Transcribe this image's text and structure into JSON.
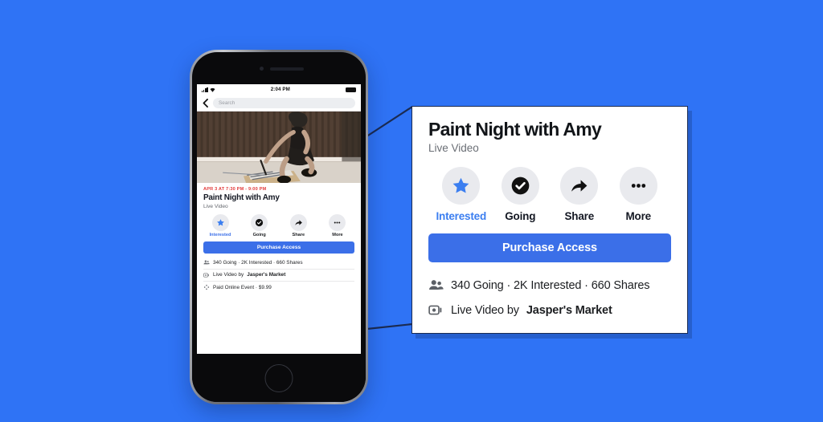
{
  "colors": {
    "background_blue": "#2f73f5",
    "brand_blue": "#3b6fe8",
    "interested_blue": "#3b7ef0",
    "panel_border": "#1b2b52",
    "date_red": "#e23b3b",
    "icon_circle_grey": "#e9eaee",
    "muted_text": "#65686e"
  },
  "phone": {
    "status_bar": {
      "time": "2:04 PM",
      "signal_icon": "signal-bars-icon",
      "wifi_icon": "wifi-icon",
      "battery_icon": "battery-icon"
    },
    "nav": {
      "back_icon": "back-chevron-icon",
      "search_placeholder": "Search",
      "search_value": ""
    },
    "hero": {
      "image_alt": "person crouching painting on a board",
      "image_name": "event-cover-photo"
    },
    "event": {
      "date_line": "APR 3 AT 7:30 PM - 9:00 PM",
      "title": "Paint Night with Amy",
      "subtitle": "Live Video"
    },
    "actions": [
      {
        "label": "Interested",
        "icon": "star-icon",
        "active": true
      },
      {
        "label": "Going",
        "icon": "check-circle-icon",
        "active": false
      },
      {
        "label": "Share",
        "icon": "share-arrow-icon",
        "active": false
      },
      {
        "label": "More",
        "icon": "ellipsis-icon",
        "active": false
      }
    ],
    "cta_label": "Purchase Access",
    "meta_rows": [
      {
        "icon": "people-icon",
        "text": "340 Going · 2K Interested · 660 Shares",
        "bold_text": ""
      },
      {
        "icon": "video-camera-icon",
        "text": "Live Video by ",
        "bold_text": "Jasper's Market"
      },
      {
        "icon": "ticket-icon",
        "text": "Paid Online Event · $9.99",
        "bold_text": ""
      }
    ]
  },
  "panel": {
    "title": "Paint Night with Amy",
    "subtitle": "Live Video",
    "actions": [
      {
        "label": "Interested",
        "icon": "star-icon",
        "active": true
      },
      {
        "label": "Going",
        "icon": "check-circle-icon",
        "active": false
      },
      {
        "label": "Share",
        "icon": "share-arrow-icon",
        "active": false
      },
      {
        "label": "More",
        "icon": "ellipsis-icon",
        "active": false
      }
    ],
    "cta_label": "Purchase Access",
    "meta_rows": [
      {
        "icon": "people-icon",
        "text": "340 Going · 2K Interested · 660 Shares",
        "bold_text": ""
      },
      {
        "icon": "video-camera-icon",
        "text": "Live Video by ",
        "bold_text": "Jasper's Market"
      }
    ]
  }
}
